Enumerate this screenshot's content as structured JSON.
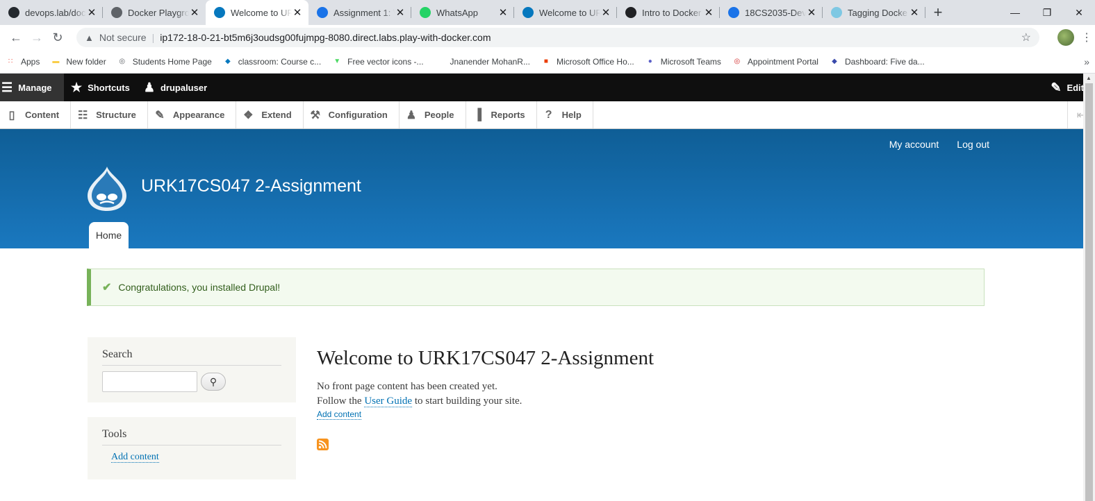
{
  "browser": {
    "tabs": [
      {
        "title": "devops.lab/doc",
        "icon": "github-icon",
        "color": "#24292e"
      },
      {
        "title": "Docker Playgro",
        "icon": "globe-icon",
        "color": "#5f6368"
      },
      {
        "title": "Welcome to UR",
        "icon": "drupal-icon",
        "color": "#0678be",
        "active": true
      },
      {
        "title": "Assignment 1: \\",
        "icon": "classroom-icon",
        "color": "#1a73e8"
      },
      {
        "title": "WhatsApp",
        "icon": "whatsapp-icon",
        "color": "#25d366"
      },
      {
        "title": "Welcome to UR",
        "icon": "drupal-icon",
        "color": "#0678be"
      },
      {
        "title": "Intro to Docker",
        "icon": "terminal-icon",
        "color": "#202124"
      },
      {
        "title": "18CS2035-Dev",
        "icon": "classroom-icon",
        "color": "#1a73e8"
      },
      {
        "title": "Tagging Docke",
        "icon": "cloud-icon",
        "color": "#7ec8e3"
      }
    ],
    "new_tab_symbol": "+",
    "security_label": "Not secure",
    "url": "ip172-18-0-21-bt5m6j3oudsg00fujmpg-8080.direct.labs.play-with-docker.com",
    "bookmarks": [
      {
        "label": "Apps",
        "icon": "apps-grid-icon",
        "color": "#ea4335"
      },
      {
        "label": "New folder",
        "icon": "folder-icon",
        "color": "#f9ce4a"
      },
      {
        "label": "Students Home Page",
        "icon": "globe-icon",
        "color": "#5f6368"
      },
      {
        "label": "classroom: Course c...",
        "icon": "drupal-icon",
        "color": "#0678be"
      },
      {
        "label": "Free vector icons -...",
        "icon": "flaticon-icon",
        "color": "#4cd964"
      },
      {
        "label": "Jnanender MohanR...",
        "icon": "blank-icon",
        "color": "#ffffff"
      },
      {
        "label": "Microsoft Office Ho...",
        "icon": "office-icon",
        "color": "#eb3c00"
      },
      {
        "label": "Microsoft Teams",
        "icon": "teams-icon",
        "color": "#5b5fc7"
      },
      {
        "label": "Appointment Portal",
        "icon": "fingerprint-icon",
        "color": "#d32f2f"
      },
      {
        "label": "Dashboard: Five da...",
        "icon": "shield-icon",
        "color": "#3949ab"
      }
    ],
    "more_bookmarks": "»"
  },
  "toolbar": {
    "manage": "Manage",
    "shortcuts": "Shortcuts",
    "user": "drupaluser",
    "edit": "Edit"
  },
  "tray": {
    "items": [
      {
        "label": "Content",
        "icon": "file-icon"
      },
      {
        "label": "Structure",
        "icon": "sitemap-icon"
      },
      {
        "label": "Appearance",
        "icon": "paintbrush-icon"
      },
      {
        "label": "Extend",
        "icon": "puzzle-icon"
      },
      {
        "label": "Configuration",
        "icon": "wrench-icon"
      },
      {
        "label": "People",
        "icon": "people-icon"
      },
      {
        "label": "Reports",
        "icon": "bar-chart-icon"
      },
      {
        "label": "Help",
        "icon": "help-icon"
      }
    ]
  },
  "header": {
    "secondary_menu": [
      "My account",
      "Log out"
    ],
    "site_name": "URK17CS047 2-Assignment",
    "primary_tab": "Home"
  },
  "status_message": "Congratulations, you installed Drupal!",
  "sidebar": {
    "search_title": "Search",
    "tools_title": "Tools",
    "tools_link": "Add content"
  },
  "main": {
    "title": "Welcome to URK17CS047 2-Assignment",
    "line1": "No front page content has been created yet.",
    "line2_prefix": "Follow the",
    "line2_link": "User Guide",
    "line2_suffix": "to start building your site.",
    "add_content": "Add content"
  },
  "colors": {
    "header_top": "#0f5e96",
    "header_bottom": "#1a78bf",
    "link": "#0071b3",
    "status_bg": "#f3faef",
    "status_accent": "#77b259"
  }
}
